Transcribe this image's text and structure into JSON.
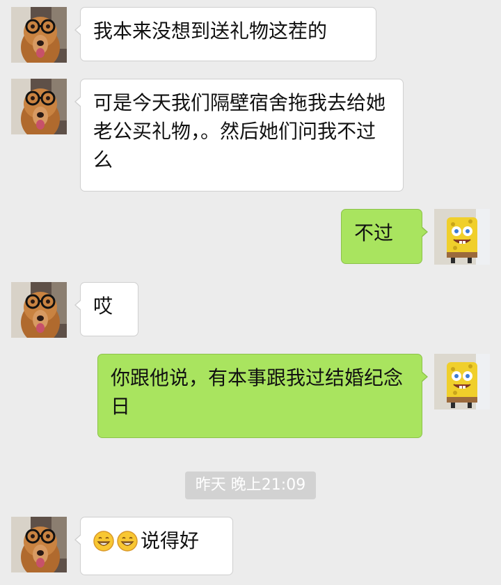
{
  "messages": [
    {
      "side": "left",
      "sender": "dog",
      "text": "我本来没想到送礼物这茬的"
    },
    {
      "side": "left",
      "sender": "dog",
      "text": "可是今天我们隔壁宿舍拖我去给她老公买礼物，。然后她们问我不过么"
    },
    {
      "side": "right",
      "sender": "spongebob",
      "text": "不过"
    },
    {
      "side": "left",
      "sender": "dog",
      "text": "哎"
    },
    {
      "side": "right",
      "sender": "spongebob",
      "text": "你跟他说，有本事跟我过结婚纪念日"
    },
    {
      "side": "left",
      "sender": "dog",
      "emoji": [
        "grin-emoji",
        "grin-emoji"
      ],
      "text": "说得好"
    }
  ],
  "timestamp": "昨天 晚上21:09",
  "colors": {
    "background": "#ececec",
    "incoming_bubble": "#ffffff",
    "outgoing_bubble": "#a9e45f",
    "timestamp_pill": "#d2d2d2"
  },
  "icons": {
    "left_avatar": "dog-with-glasses-avatar",
    "right_avatar": "spongebob-avatar",
    "emoji": "grin-emoji"
  }
}
